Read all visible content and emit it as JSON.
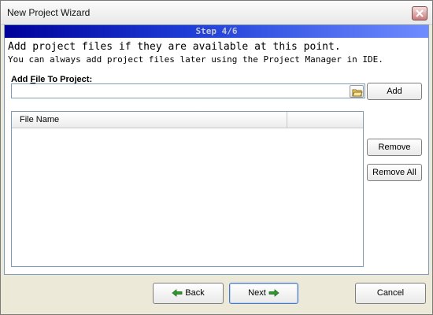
{
  "window": {
    "title": "New Project Wizard"
  },
  "step": {
    "label": "Step 4/6"
  },
  "intro": {
    "heading": "Add project files if they are available at this point.",
    "subheading": "You can always add project files later using the Project Manager in IDE."
  },
  "field": {
    "label_prefix": "Add ",
    "label_underline": "F",
    "label_suffix": "ile To Project:",
    "value": ""
  },
  "buttons": {
    "add": "Add",
    "remove": "Remove",
    "remove_all": "Remove All",
    "back": "Back",
    "next": "Next",
    "cancel": "Cancel"
  },
  "list": {
    "columns": [
      "File Name",
      ""
    ],
    "rows": []
  },
  "icons": {
    "close": "close-icon",
    "browse": "folder-open-icon",
    "back": "green-left-arrow-icon",
    "next": "green-right-arrow-icon"
  },
  "colors": {
    "step_bar_start": "#00009a",
    "step_bar_end": "#6f8cff",
    "arrow_green": "#2e9a2e"
  }
}
